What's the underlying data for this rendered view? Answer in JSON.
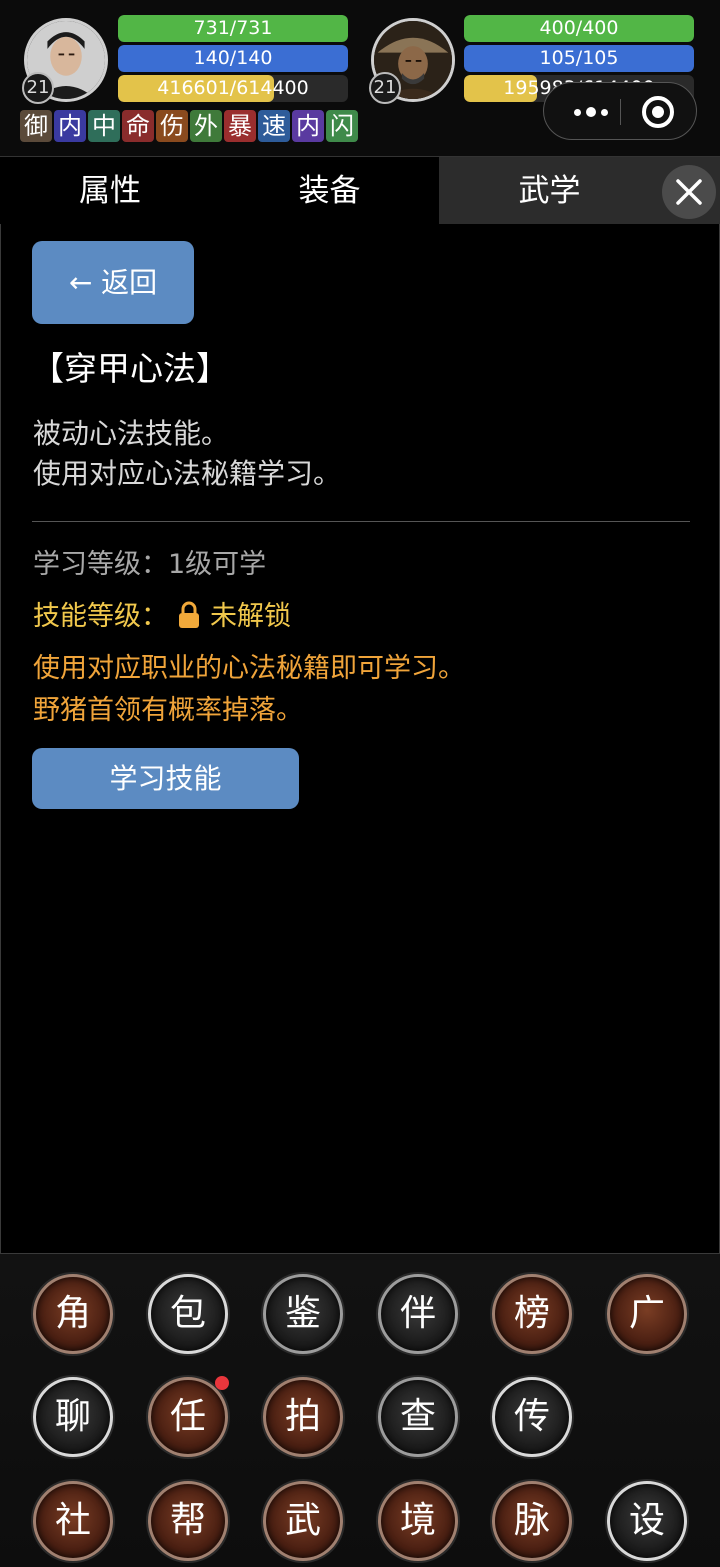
{
  "characters": [
    {
      "level": "21",
      "hp": "731/731",
      "hp_fraction": 1.0,
      "mp": "140/140",
      "mp_fraction": 1.0,
      "xp": "416601/614400",
      "xp_fraction": 0.678
    },
    {
      "level": "21",
      "hp": "400/400",
      "hp_fraction": 1.0,
      "mp": "105/105",
      "mp_fraction": 1.0,
      "xp": "195983/614400",
      "xp_fraction": 0.319
    }
  ],
  "buffs": [
    {
      "label": "御",
      "color": "#5b4a3a"
    },
    {
      "label": "内",
      "color": "#3a3aa0"
    },
    {
      "label": "中",
      "color": "#2f6e5a"
    },
    {
      "label": "命",
      "color": "#8a2c2c"
    },
    {
      "label": "伤",
      "color": "#8a4a1e"
    },
    {
      "label": "外",
      "color": "#3f7a3a"
    },
    {
      "label": "暴",
      "color": "#9a2e2e"
    },
    {
      "label": "速",
      "color": "#2e5c9a"
    },
    {
      "label": "内",
      "color": "#5a3aa0"
    },
    {
      "label": "闪",
      "color": "#3f8a4a"
    }
  ],
  "tabs": [
    {
      "label": "属性"
    },
    {
      "label": "装备"
    },
    {
      "label": "武学"
    }
  ],
  "detail": {
    "back_label": "← 返回",
    "title": "【穿甲心法】",
    "desc_line1": "被动心法技能。",
    "desc_line2": "使用对应心法秘籍学习。",
    "learn_level": "学习等级：1级可学",
    "skill_level_prefix": "技能等级：",
    "skill_level_value": "未解锁",
    "hint_line1": "使用对应职业的心法秘籍即可学习。",
    "hint_line2": "野猪首领有概率掉落。",
    "learn_button": "学习技能"
  },
  "dock": {
    "row1": [
      "角",
      "包",
      "鉴",
      "伴",
      "榜",
      "广"
    ],
    "row2": [
      "聊",
      "任",
      "拍",
      "查",
      "传"
    ],
    "row3": [
      "社",
      "帮",
      "武",
      "境",
      "脉",
      "设"
    ]
  },
  "colors": {
    "hp": "#52b646",
    "mp": "#3b6ed3",
    "xp": "#e3c34a",
    "button_blue": "#5c8bc2",
    "text_yellow": "#f1c84c",
    "text_orange": "#f0a43a"
  }
}
